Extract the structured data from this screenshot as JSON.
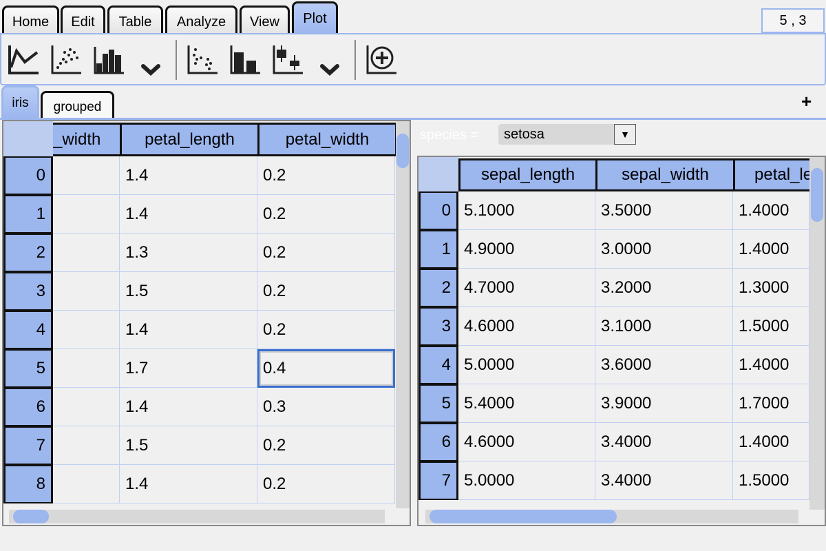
{
  "ribbon_tabs": [
    {
      "label": "Home"
    },
    {
      "label": "Edit"
    },
    {
      "label": "Table"
    },
    {
      "label": "Analyze"
    },
    {
      "label": "View"
    },
    {
      "label": "Plot",
      "active": true
    }
  ],
  "status": {
    "cursor": "5 , 3"
  },
  "toolbar": {
    "icons": [
      "line-chart-icon",
      "scatter-chart-icon",
      "histogram-icon",
      "chevron-down-icon",
      "grouped-scatter-icon",
      "grouped-bar-icon",
      "boxplot-icon",
      "chevron-down-icon",
      "add-plot-icon"
    ]
  },
  "sheet_tabs": [
    {
      "label": "iris",
      "active": true
    },
    {
      "label": "grouped"
    }
  ],
  "add_sheet_label": "+",
  "left_table": {
    "columns": [
      "_width",
      "petal_length",
      "petal_width"
    ],
    "rows": [
      {
        "index": "0",
        "values": [
          "",
          "1.4",
          "0.2"
        ]
      },
      {
        "index": "1",
        "values": [
          "",
          "1.4",
          "0.2"
        ]
      },
      {
        "index": "2",
        "values": [
          "",
          "1.3",
          "0.2"
        ]
      },
      {
        "index": "3",
        "values": [
          "",
          "1.5",
          "0.2"
        ]
      },
      {
        "index": "4",
        "values": [
          "",
          "1.4",
          "0.2"
        ]
      },
      {
        "index": "5",
        "values": [
          "",
          "1.7",
          "0.4"
        ]
      },
      {
        "index": "6",
        "values": [
          "",
          "1.4",
          "0.3"
        ]
      },
      {
        "index": "7",
        "values": [
          "",
          "1.5",
          "0.2"
        ]
      },
      {
        "index": "8",
        "values": [
          "",
          "1.4",
          "0.2"
        ]
      }
    ],
    "selected": {
      "row": 5,
      "col": 2
    }
  },
  "filter": {
    "label": "species =",
    "value": "setosa"
  },
  "right_table": {
    "columns": [
      "sepal_length",
      "sepal_width",
      "petal_le"
    ],
    "rows": [
      {
        "index": "0",
        "values": [
          "5.1000",
          "3.5000",
          "1.4000"
        ]
      },
      {
        "index": "1",
        "values": [
          "4.9000",
          "3.0000",
          "1.4000"
        ]
      },
      {
        "index": "2",
        "values": [
          "4.7000",
          "3.2000",
          "1.3000"
        ]
      },
      {
        "index": "3",
        "values": [
          "4.6000",
          "3.1000",
          "1.5000"
        ]
      },
      {
        "index": "4",
        "values": [
          "5.0000",
          "3.6000",
          "1.4000"
        ]
      },
      {
        "index": "5",
        "values": [
          "5.4000",
          "3.9000",
          "1.7000"
        ]
      },
      {
        "index": "6",
        "values": [
          "4.6000",
          "3.4000",
          "1.4000"
        ]
      },
      {
        "index": "7",
        "values": [
          "5.0000",
          "3.4000",
          "1.5000"
        ]
      }
    ]
  },
  "colors": {
    "accent": "#9cb6ee",
    "selection": "#3a6fd0"
  }
}
